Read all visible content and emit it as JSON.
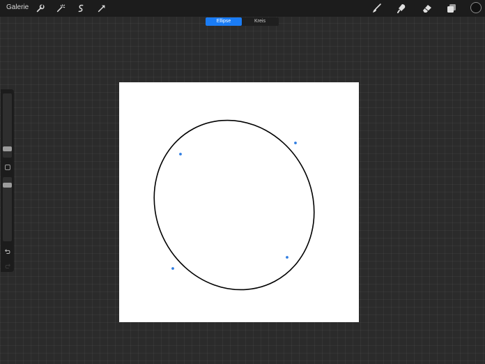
{
  "toolbar": {
    "gallery_label": "Galerie",
    "left_tools": [
      {
        "name": "wrench-icon"
      },
      {
        "name": "magic-wand-icon"
      },
      {
        "name": "selection-icon"
      },
      {
        "name": "transform-arrow-icon"
      }
    ],
    "right_tools": [
      {
        "name": "brush-icon"
      },
      {
        "name": "smudge-icon"
      },
      {
        "name": "eraser-icon"
      },
      {
        "name": "layers-icon"
      }
    ],
    "current_color": "#111111"
  },
  "shape_mode": {
    "options": [
      "Ellipse",
      "Kreis"
    ],
    "selected": "Ellipse",
    "accent": "#1a7cf5"
  },
  "sidebar": {
    "undo_icon": "undo-icon",
    "redo_icon": "redo-icon"
  },
  "canvas": {
    "shape": "ellipse",
    "stroke_color": "#000000",
    "handle_color": "#2f7de1"
  }
}
